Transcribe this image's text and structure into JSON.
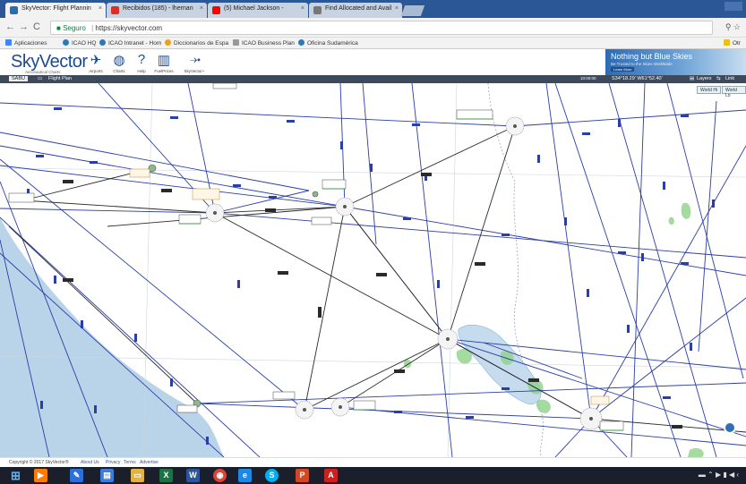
{
  "browser": {
    "tabs": [
      {
        "label": "SkyVector: Flight Plannin",
        "color": "#2b6cb0",
        "active": true
      },
      {
        "label": "Recibidos (185) - lhernan",
        "color": "#d93025",
        "active": false
      },
      {
        "label": "(5) Michael Jackson - ",
        "color": "#ff0000",
        "active": false
      },
      {
        "label": "Find Allocated and Avail",
        "color": "#777777",
        "active": false
      }
    ],
    "security_label": "Seguro",
    "url": "https://skyvector.com",
    "bookmarks": [
      {
        "label": "Aplicaciones",
        "color": "#4285f4"
      },
      {
        "label": "ICAO HQ",
        "color": "#2a7ab8"
      },
      {
        "label": "ICAO Intranet - Hom",
        "color": "#2a7ab8"
      },
      {
        "label": "Diccionarios de Espa",
        "color": "#e8a317"
      },
      {
        "label": "ICAO Business Plan",
        "color": "#999999"
      },
      {
        "label": "Oficina Sudamérica",
        "color": "#2a7ab8"
      }
    ],
    "bookmarks_overflow": "Otr"
  },
  "skyvector": {
    "logo": "SkyVector",
    "logo_sub": "Aeronautical Charts",
    "nav": [
      {
        "label": "Airports",
        "icon": "airplane-icon"
      },
      {
        "label": "Charts",
        "icon": "globe-icon"
      },
      {
        "label": "Help",
        "icon": "help-icon"
      },
      {
        "label": "FuelPrices",
        "icon": "fuel-icon"
      },
      {
        "label": "SkyVector+",
        "icon": "plane-silhouette-icon"
      }
    ],
    "ad": {
      "title": "Nothing but Blue Skies",
      "subtitle": "Be Trusted to the Skies Worldwide",
      "cta": "Learn More"
    },
    "toolbar": {
      "code": "SABU",
      "flight_plan": "Flight Plan",
      "zoom": "10:00:00",
      "coords": "S34°18.29' W61°52.40'",
      "layers": "Layers",
      "link": "Link"
    },
    "map_buttons": [
      "World Hi",
      "World Lo"
    ],
    "footer": {
      "copyright": "Copyright © 2017 SkyVector®",
      "links": [
        "About Us",
        "Privacy",
        "Terms",
        "Advertise"
      ]
    }
  },
  "taskbar": {
    "apps": [
      {
        "icon": "windows-start-icon",
        "color": "#1e88e5",
        "glyph": "⊞"
      },
      {
        "icon": "media-player-icon",
        "color": "#ff7b00",
        "glyph": "▶"
      },
      {
        "icon": "paint-icon",
        "color": "#2a6fdb",
        "glyph": "✎"
      },
      {
        "icon": "sticky-notes-icon",
        "color": "#3b7ddd",
        "glyph": "▤"
      },
      {
        "icon": "explorer-folder-icon",
        "color": "#e3b341",
        "glyph": "▭"
      },
      {
        "icon": "excel-icon",
        "color": "#1e7145",
        "glyph": "X"
      },
      {
        "icon": "word-icon",
        "color": "#2b579a",
        "glyph": "W"
      },
      {
        "icon": "chrome-icon",
        "color": "#db4437",
        "glyph": "◉"
      },
      {
        "icon": "edge-icon",
        "color": "#1e88e5",
        "glyph": "e"
      },
      {
        "icon": "skype-icon",
        "color": "#00aff0",
        "glyph": "S"
      },
      {
        "icon": "powerpoint-icon",
        "color": "#d24726",
        "glyph": "P"
      },
      {
        "icon": "acrobat-icon",
        "color": "#cc1f1f",
        "glyph": "A"
      }
    ]
  }
}
